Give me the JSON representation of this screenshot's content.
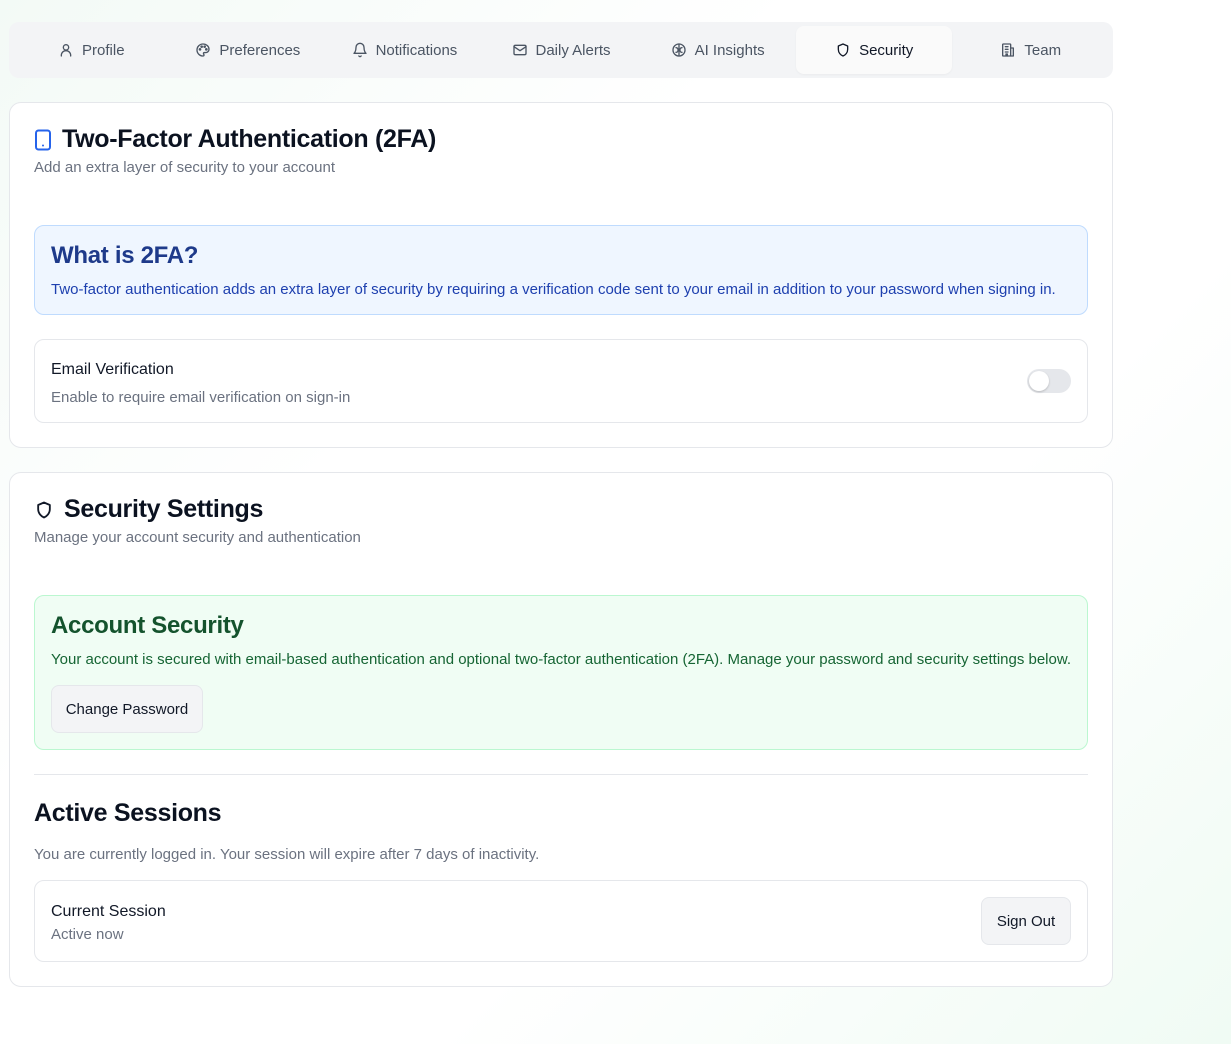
{
  "tabs": [
    {
      "label": "Profile",
      "icon": "user-icon"
    },
    {
      "label": "Preferences",
      "icon": "palette-icon"
    },
    {
      "label": "Notifications",
      "icon": "bell-icon"
    },
    {
      "label": "Daily Alerts",
      "icon": "mail-icon"
    },
    {
      "label": "AI Insights",
      "icon": "brain-icon"
    },
    {
      "label": "Security",
      "icon": "shield-icon",
      "active": true
    },
    {
      "label": "Team",
      "icon": "building-icon"
    }
  ],
  "two_factor": {
    "title": "Two-Factor Authentication (2FA)",
    "subtitle": "Add an extra layer of security to your account",
    "info_title": "What is 2FA?",
    "info_text": "Two-factor authentication adds an extra layer of security by requiring a verification code sent to your email in addition to your password when signing in.",
    "email_verification": {
      "title": "Email Verification",
      "description": "Enable to require email verification on sign-in",
      "enabled": false
    }
  },
  "security_settings": {
    "title": "Security Settings",
    "subtitle": "Manage your account security and authentication",
    "account_title": "Account Security",
    "account_text": "Your account is secured with email-based authentication and optional two-factor authentication (2FA). Manage your password and security settings below.",
    "change_password_label": "Change Password",
    "sessions_title": "Active Sessions",
    "sessions_text": "You are currently logged in. Your session will expire after 7 days of inactivity.",
    "current_session_title": "Current Session",
    "current_session_status": "Active now",
    "sign_out_label": "Sign Out"
  },
  "colors": {
    "accent_blue": "#2563eb",
    "info_blue_bg": "#eff6ff",
    "info_green_bg": "#f0fdf4",
    "green_heading": "#14532d"
  }
}
